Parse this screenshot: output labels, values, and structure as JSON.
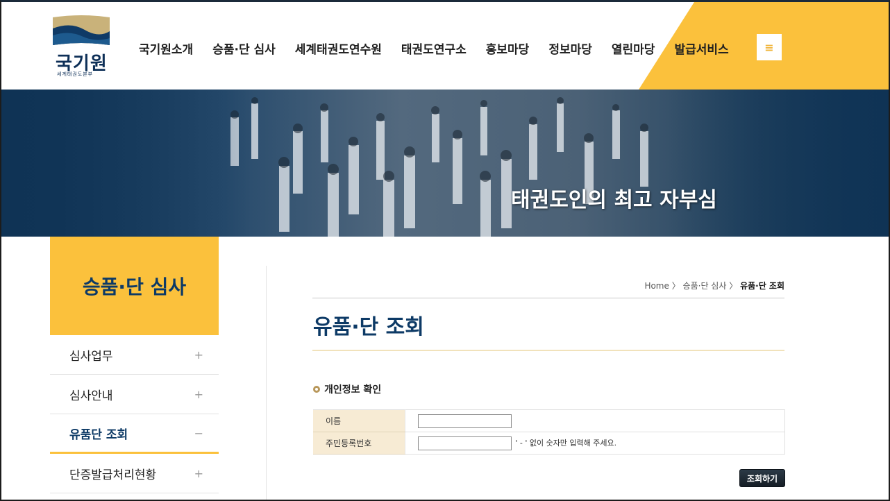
{
  "header": {
    "logo": {
      "title": "국기원",
      "subtitle": "세계태권도본부"
    },
    "nav": [
      {
        "label": "국기원소개"
      },
      {
        "label": "승품·단 심사"
      },
      {
        "label": "세계태권도연수원"
      },
      {
        "label": "태권도연구소"
      },
      {
        "label": "홍보마당"
      },
      {
        "label": "정보마당"
      },
      {
        "label": "열린마당"
      },
      {
        "label": "발급서비스"
      }
    ],
    "menu_icon": "hamburger-icon",
    "accent_color": "#fbc13c"
  },
  "banner": {
    "slogan": "태권도인의 최고 자부심"
  },
  "sidebar": {
    "title": "승품·단 심사",
    "items": [
      {
        "label": "심사업무",
        "sign": "+"
      },
      {
        "label": "심사안내",
        "sign": "+"
      },
      {
        "label": "유품단 조회",
        "sign": "−"
      },
      {
        "label": "단증발급처리현황",
        "sign": "+"
      }
    ]
  },
  "main": {
    "breadcrumb": {
      "home": "Home",
      "sep1": "〉",
      "section": "승품·단 심사",
      "sep2": "〉",
      "current": "유품·단 조회"
    },
    "title": "유품·단 조회",
    "section_title": "개인정보 확인",
    "form": {
      "name_label": "이름",
      "name_value": "",
      "id_label": "주민등록번호",
      "id_value": "",
      "id_hint": "' - ' 없이 숫자만 입력해 주세요."
    },
    "submit_label": "조회하기"
  }
}
